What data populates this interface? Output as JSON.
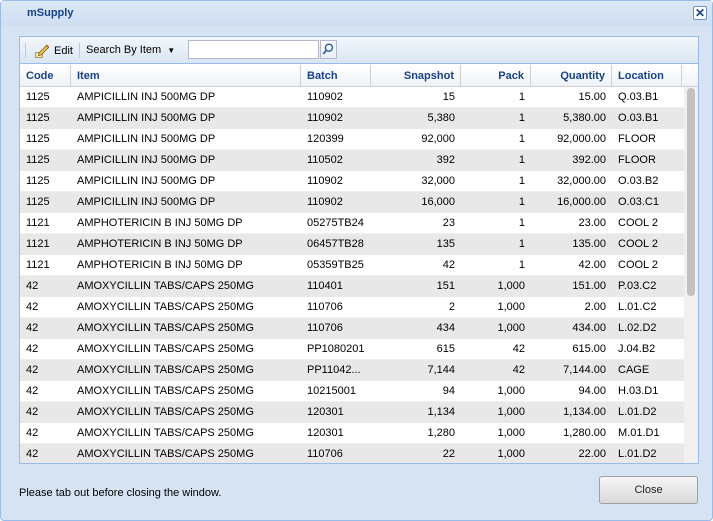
{
  "window": {
    "title": "mSupply",
    "close_glyph": "✕"
  },
  "toolbar": {
    "edit_label": "Edit",
    "edit_icon": "pencil-icon",
    "search_by_label": "Search By Item",
    "search_value": "",
    "search_icon": "magnifier-icon"
  },
  "columns": [
    "Code",
    "Item",
    "Batch",
    "Snapshot",
    "Pack",
    "Quantity",
    "Location"
  ],
  "rows": [
    [
      "1125",
      "AMPICILLIN INJ 500MG DP",
      "110902",
      "15",
      "1",
      "15.00",
      "Q.03.B1"
    ],
    [
      "1125",
      "AMPICILLIN INJ 500MG DP",
      "110902",
      "5,380",
      "1",
      "5,380.00",
      "O.03.B1"
    ],
    [
      "1125",
      "AMPICILLIN INJ 500MG DP",
      "120399",
      "92,000",
      "1",
      "92,000.00",
      "FLOOR"
    ],
    [
      "1125",
      "AMPICILLIN INJ 500MG DP",
      "110502",
      "392",
      "1",
      "392.00",
      "FLOOR"
    ],
    [
      "1125",
      "AMPICILLIN INJ 500MG DP",
      "110902",
      "32,000",
      "1",
      "32,000.00",
      "O.03.B2"
    ],
    [
      "1125",
      "AMPICILLIN INJ 500MG DP",
      "110902",
      "16,000",
      "1",
      "16,000.00",
      "O.03.C1"
    ],
    [
      "1121",
      "AMPHOTERICIN B INJ 50MG DP",
      "05275TB24",
      "23",
      "1",
      "23.00",
      "COOL 2"
    ],
    [
      "1121",
      "AMPHOTERICIN B INJ 50MG DP",
      "06457TB28",
      "135",
      "1",
      "135.00",
      "COOL 2"
    ],
    [
      "1121",
      "AMPHOTERICIN B INJ 50MG DP",
      "05359TB25",
      "42",
      "1",
      "42.00",
      "COOL 2"
    ],
    [
      "42",
      "AMOXYCILLIN TABS/CAPS 250MG",
      "110401",
      "151",
      "1,000",
      "151.00",
      "P.03.C2"
    ],
    [
      "42",
      "AMOXYCILLIN TABS/CAPS 250MG",
      "110706",
      "2",
      "1,000",
      "2.00",
      "L.01.C2"
    ],
    [
      "42",
      "AMOXYCILLIN TABS/CAPS 250MG",
      "110706",
      "434",
      "1,000",
      "434.00",
      "L.02.D2"
    ],
    [
      "42",
      "AMOXYCILLIN TABS/CAPS 250MG",
      "PP1080201",
      "615",
      "42",
      "615.00",
      "J.04.B2"
    ],
    [
      "42",
      "AMOXYCILLIN TABS/CAPS 250MG",
      "PP11042...",
      "7,144",
      "42",
      "7,144.00",
      "CAGE"
    ],
    [
      "42",
      "AMOXYCILLIN TABS/CAPS 250MG",
      "10215001",
      "94",
      "1,000",
      "94.00",
      "H.03.D1"
    ],
    [
      "42",
      "AMOXYCILLIN TABS/CAPS 250MG",
      "120301",
      "1,134",
      "1,000",
      "1,134.00",
      "L.01.D2"
    ],
    [
      "42",
      "AMOXYCILLIN TABS/CAPS 250MG",
      "120301",
      "1,280",
      "1,000",
      "1,280.00",
      "M.01.D1"
    ],
    [
      "42",
      "AMOXYCILLIN TABS/CAPS 250MG",
      "110706",
      "22",
      "1,000",
      "22.00",
      "L.01.D2"
    ]
  ],
  "footer": {
    "message": "Please tab out before closing the window.",
    "close_label": "Close"
  }
}
